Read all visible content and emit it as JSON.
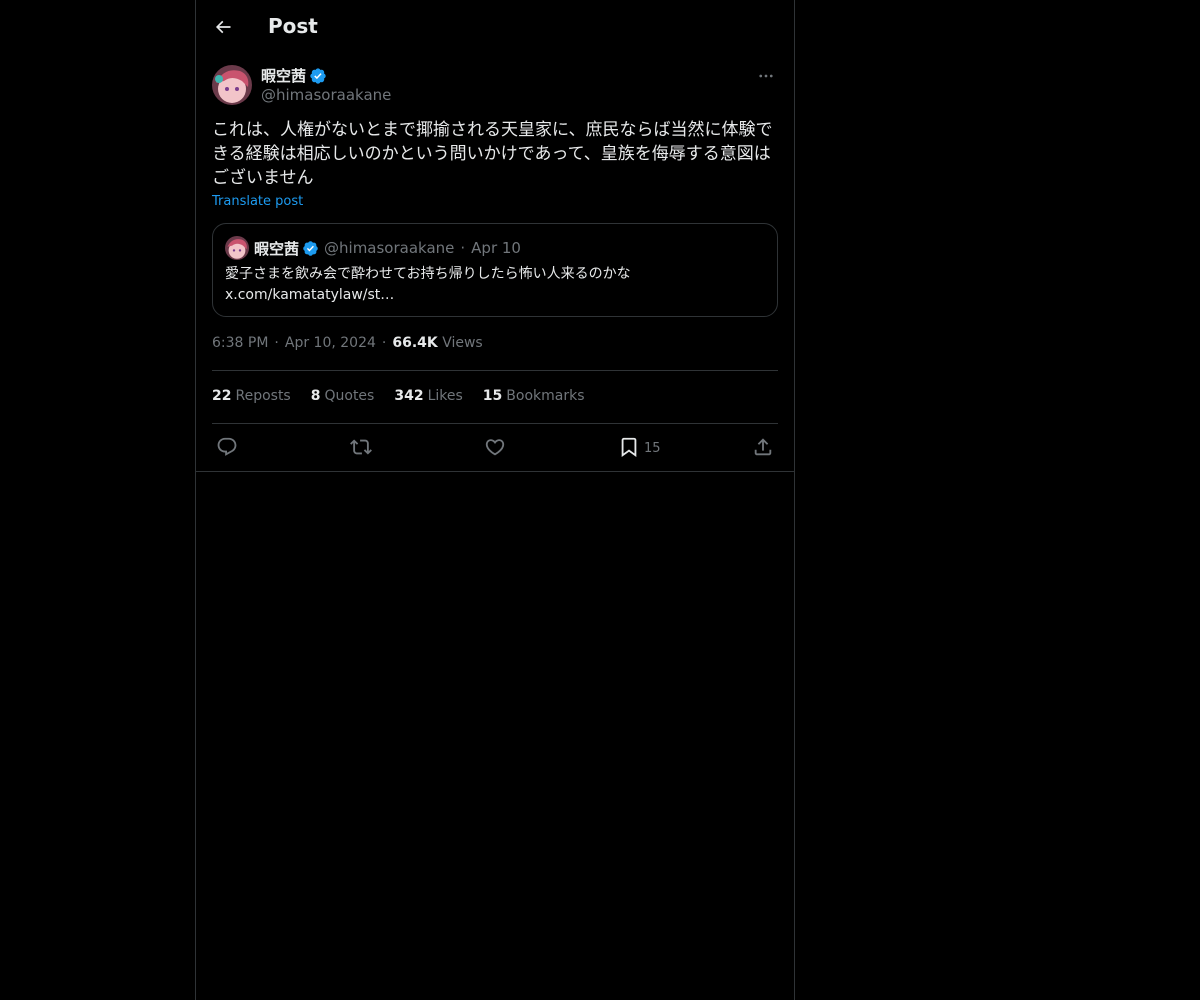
{
  "header": {
    "title": "Post",
    "back_icon": "arrow-left-icon"
  },
  "post": {
    "author_name": "暇空茜",
    "author_handle": "@himasoraakane",
    "verified_color": "#1d9bf0",
    "text": "これは、人権がないとまで揶揄される天皇家に、庶民ならば当然に体験できる経験は相応しいのかという問いかけであって、皇族を侮辱する意図はございません",
    "translate_label": "Translate post",
    "time": "6:38 PM",
    "date": "Apr 10, 2024",
    "views_count": "66.4K",
    "views_label": "Views"
  },
  "quote": {
    "author_name": "暇空茜",
    "author_handle": "@himasoraakane",
    "date": "Apr 10",
    "text_line1": "愛子さまを飲み会で酔わせてお持ち帰りしたら怖い人来るのかな",
    "text_line2": "x.com/kamatatylaw/st…"
  },
  "stats": {
    "reposts_count": "22",
    "reposts_label": "Reposts",
    "quotes_count": "8",
    "quotes_label": "Quotes",
    "likes_count": "342",
    "likes_label": "Likes",
    "bookmarks_count": "15",
    "bookmarks_label": "Bookmarks"
  },
  "actions": {
    "reply_icon": "reply-icon",
    "repost_icon": "repost-icon",
    "like_icon": "heart-icon",
    "bookmark_icon": "bookmark-icon",
    "bookmark_count": "15",
    "share_icon": "share-icon"
  },
  "colors": {
    "background": "#000000",
    "text_primary": "#e7e9ea",
    "text_secondary": "#71767b",
    "border": "#2f3336",
    "accent": "#1d9bf0"
  }
}
